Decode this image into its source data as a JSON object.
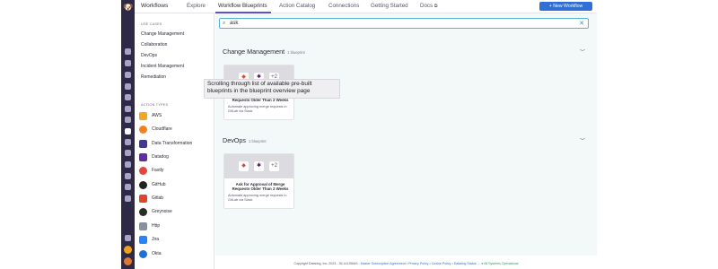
{
  "nav": {
    "brand": "Workflows",
    "tabs": [
      "Explore",
      "Workflow Blueprints",
      "Action Catalog",
      "Connections",
      "Getting Started",
      "Docs"
    ],
    "docs_external_glyph": "⧉",
    "new_button": "+ New Workflow"
  },
  "sidebar": {
    "use_cases_header": "USE CASES",
    "use_cases": [
      "Change Management",
      "Collaboration",
      "DevOps",
      "Incident Management",
      "Remediation"
    ],
    "action_types_header": "ACTION TYPES",
    "action_types": [
      {
        "label": "AWS",
        "color": "#f5a623"
      },
      {
        "label": "Cloudflare",
        "color": "#f48120"
      },
      {
        "label": "Data Transformation",
        "color": "#3f3a8f"
      },
      {
        "label": "Datadog",
        "color": "#632ca6"
      },
      {
        "label": "Fastly",
        "color": "#e5453a"
      },
      {
        "label": "GitHub",
        "color": "#222222"
      },
      {
        "label": "Gitlab",
        "color": "#e2432a"
      },
      {
        "label": "Greynoise",
        "color": "#2b2b2b"
      },
      {
        "label": "Http",
        "color": "#8a8f9e"
      },
      {
        "label": "Jira",
        "color": "#2684ff"
      },
      {
        "label": "Okta",
        "color": "#1f6fd6"
      }
    ]
  },
  "tooltip": "Scrolling through list of available pre-built blueprints in the blueprint overview page",
  "search": {
    "value": "ask"
  },
  "sections": [
    {
      "title": "Change Management",
      "count": "1 blueprint",
      "card": {
        "name": "Ask for Approval of Merge Requests Older Than 2 Weeks",
        "desc": "Automate approving merge requests in GitLab via Slack",
        "icons": [
          "gitlab-icon",
          "slack-icon",
          "+2"
        ]
      }
    },
    {
      "title": "DevOps",
      "count": "1 blueprint",
      "card": {
        "name": "Ask for Approval of Merge Requests Older Than 2 Weeks",
        "desc": "Automate approving merge requests in GitLab via Slack",
        "icons": [
          "gitlab-icon",
          "slack-icon",
          "+2"
        ]
      }
    }
  ],
  "footer": {
    "copyright": "Copyright Datadog, Inc. 2023 - 35.14135649 - ",
    "links": [
      "Master Subscription Agreement",
      "Privacy Policy",
      "Cookie Policy",
      "Datadog Status →"
    ],
    "status": "● All Systems Operational"
  },
  "colors": {
    "accent": "#5b4fd6",
    "primary_button": "#2f6fd6",
    "rail": "#2e2946",
    "search_border": "#56b3d6"
  }
}
